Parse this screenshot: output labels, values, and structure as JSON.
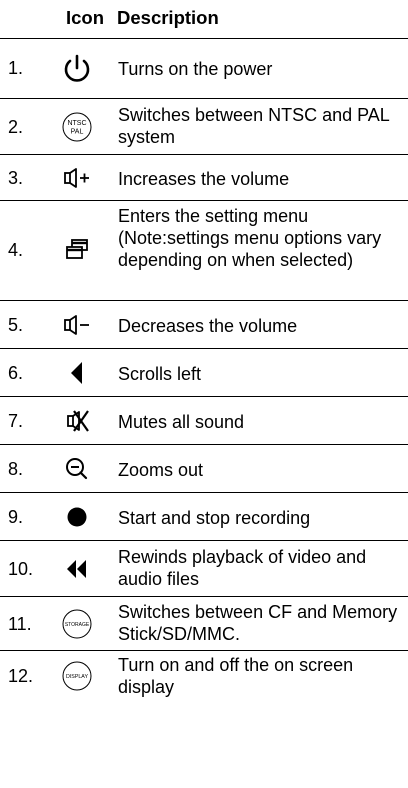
{
  "header": {
    "icon": "Icon",
    "description": "Description"
  },
  "rows": [
    {
      "num": "1.",
      "icon": "power-icon",
      "desc": "Turns on the power"
    },
    {
      "num": "2.",
      "icon": "ntsc-pal-icon",
      "icon_text_top": "NTSC",
      "icon_text_bottom": "PAL",
      "desc": "Switches between NTSC and PAL system"
    },
    {
      "num": "3.",
      "icon": "volume-up-icon",
      "desc": "Increases the volume"
    },
    {
      "num": "4.",
      "icon": "settings-menu-icon",
      "desc": "Enters the setting menu (Note:settings menu options vary depending on when selected)"
    },
    {
      "num": "5.",
      "icon": "volume-down-icon",
      "desc": "Decreases the volume"
    },
    {
      "num": "6.",
      "icon": "scroll-left-icon",
      "desc": "Scrolls left"
    },
    {
      "num": "7.",
      "icon": "mute-icon",
      "desc": "Mutes all sound"
    },
    {
      "num": "8.",
      "icon": "zoom-out-icon",
      "desc": "Zooms out"
    },
    {
      "num": "9.",
      "icon": "record-icon",
      "desc": "Start and stop recording"
    },
    {
      "num": "10.",
      "icon": "rewind-icon",
      "desc": "Rewinds playback of video and audio files"
    },
    {
      "num": "11.",
      "icon": "storage-icon",
      "icon_text": "STORAGE",
      "desc": "Switches between CF and Memory Stick/SD/MMC."
    },
    {
      "num": "12.",
      "icon": "display-icon",
      "icon_text": "DISPLAY",
      "desc": "Turn on and off the on screen display"
    }
  ]
}
